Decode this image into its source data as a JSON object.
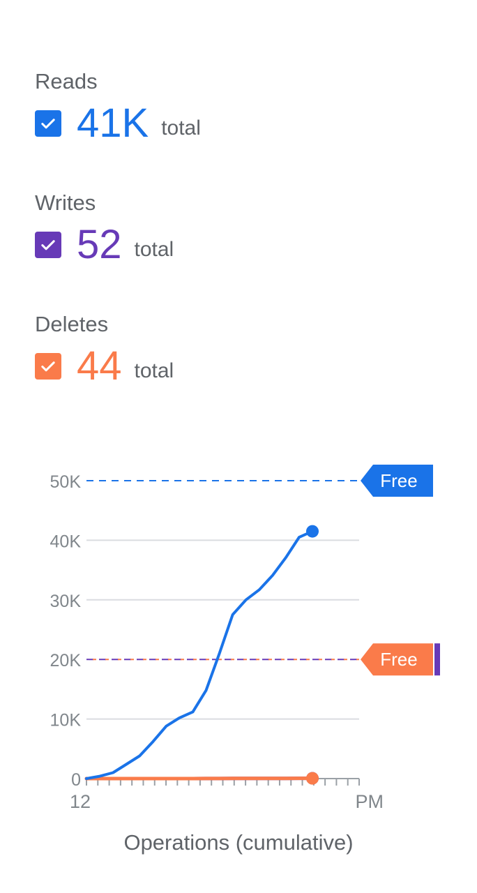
{
  "metrics": [
    {
      "label": "Reads",
      "value": "41K",
      "suffix": "total",
      "color": "#1a73e8"
    },
    {
      "label": "Writes",
      "value": "52",
      "suffix": "total",
      "color": "#673ab7"
    },
    {
      "label": "Deletes",
      "value": "44",
      "suffix": "total",
      "color": "#fa7b4a"
    }
  ],
  "chart_data": {
    "type": "line",
    "xlabel": "Operations (cumulative)",
    "ylabel": "",
    "ylim": [
      0,
      50000
    ],
    "yticks": [
      "0",
      "10K",
      "20K",
      "30K",
      "40K",
      "50K"
    ],
    "x_tick_labels_legible": [
      "12",
      "PM"
    ],
    "grid": true,
    "series": [
      {
        "name": "Reads",
        "color": "#1a73e8",
        "values": [
          0,
          400,
          1000,
          2400,
          3800,
          6200,
          8800,
          10200,
          11200,
          14800,
          21000,
          27500,
          30000,
          31700,
          34100,
          37100,
          40500,
          41500
        ]
      },
      {
        "name": "Writes",
        "color": "#673ab7",
        "values": [
          0,
          0,
          0,
          0,
          0,
          0,
          0,
          0,
          0,
          10,
          15,
          20,
          25,
          30,
          35,
          40,
          45,
          52
        ]
      },
      {
        "name": "Deletes",
        "color": "#fa7b4a",
        "values": [
          0,
          0,
          0,
          0,
          0,
          0,
          0,
          0,
          0,
          10,
          15,
          20,
          25,
          30,
          35,
          38,
          41,
          44
        ]
      }
    ],
    "limits": [
      {
        "label": "Free",
        "value": 50000,
        "color": "#1a73e8"
      },
      {
        "label": "Free",
        "value": 20000,
        "color": "#fa7b4a",
        "secondary_color": "#673ab7"
      }
    ]
  }
}
